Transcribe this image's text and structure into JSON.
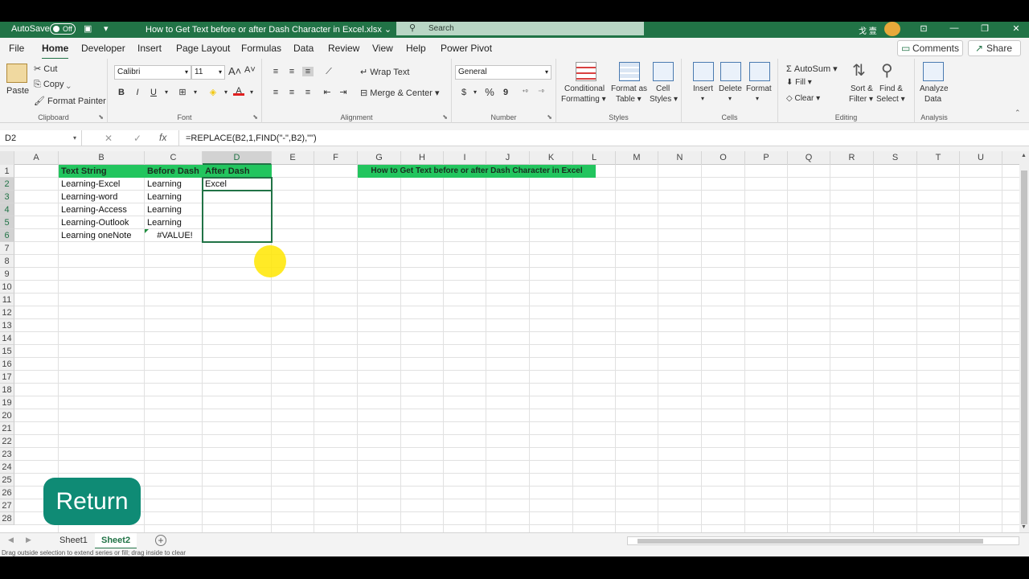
{
  "title_bar": {
    "autosave_label": "AutoSave",
    "autosave_state": "Off",
    "doc_title": "How to Get Text before or after Dash Character in Excel.xlsx",
    "search_placeholder": "Search",
    "user_name": "戈 壹"
  },
  "tabs": [
    "File",
    "Home",
    "Developer",
    "Insert",
    "Page Layout",
    "Formulas",
    "Data",
    "Review",
    "View",
    "Help",
    "Power Pivot"
  ],
  "active_tab": "Home",
  "comments_label": "Comments",
  "share_label": "Share",
  "ribbon": {
    "clipboard": {
      "paste": "Paste",
      "cut": "Cut",
      "copy": "Copy",
      "format_painter": "Format Painter",
      "label": "Clipboard"
    },
    "font": {
      "family": "Calibri",
      "size": "11",
      "bold": "B",
      "italic": "I",
      "underline": "U",
      "label": "Font"
    },
    "alignment": {
      "wrap_text": "Wrap Text",
      "merge_center": "Merge & Center",
      "label": "Alignment"
    },
    "number": {
      "format": "General",
      "currency": "$",
      "percent": "%",
      "comma": "9",
      "label": "Number"
    },
    "styles": {
      "conditional": "Conditional",
      "conditional2": "Formatting",
      "format_as": "Format as",
      "format_as2": "Table",
      "cell": "Cell",
      "cell2": "Styles",
      "label": "Styles"
    },
    "cells": {
      "insert": "Insert",
      "delete": "Delete",
      "format": "Format",
      "label": "Cells"
    },
    "editing": {
      "autosum": "AutoSum",
      "fill": "Fill",
      "clear": "Clear",
      "sort": "Sort &",
      "sort2": "Filter",
      "find": "Find &",
      "find2": "Select",
      "label": "Editing"
    },
    "analysis": {
      "analyze": "Analyze",
      "analyze2": "Data",
      "label": "Analysis"
    }
  },
  "formula_bar": {
    "name_box": "D2",
    "fx": "fx",
    "formula": "=REPLACE(B2,1,FIND(\"-\",B2),\"\")"
  },
  "columns": [
    "A",
    "B",
    "C",
    "D",
    "E",
    "F",
    "G",
    "H",
    "I",
    "J",
    "K",
    "L",
    "M",
    "N",
    "O",
    "P",
    "Q",
    "R",
    "S",
    "T",
    "U"
  ],
  "rows": [
    "1",
    "2",
    "3",
    "4",
    "5",
    "6",
    "7",
    "8",
    "9",
    "10",
    "11",
    "12",
    "13",
    "14",
    "15",
    "16",
    "17",
    "18",
    "19",
    "20",
    "21",
    "22",
    "23",
    "24",
    "25",
    "26",
    "27",
    "28"
  ],
  "table": {
    "headers": [
      "Text String",
      "Before Dash",
      "After Dash"
    ],
    "rows": [
      [
        "Learning-Excel",
        "Learning",
        "Excel"
      ],
      [
        "Learning-word",
        "Learning",
        ""
      ],
      [
        "Learning-Access",
        "Learning",
        ""
      ],
      [
        "Learning-Outlook",
        "Learning",
        ""
      ],
      [
        "Learning oneNote",
        "#VALUE!",
        ""
      ]
    ]
  },
  "banner_title": "How to Get Text before or after Dash Character in Excel",
  "return_button": "Return",
  "sheets": [
    "Sheet1",
    "Sheet2"
  ],
  "active_sheet": "Sheet2",
  "status_message": "Drag outside selection to extend series or fill; drag inside to clear",
  "colors": {
    "excel_green": "#217346",
    "header_fill": "#22c55e",
    "return_fill": "#0f8b75"
  }
}
